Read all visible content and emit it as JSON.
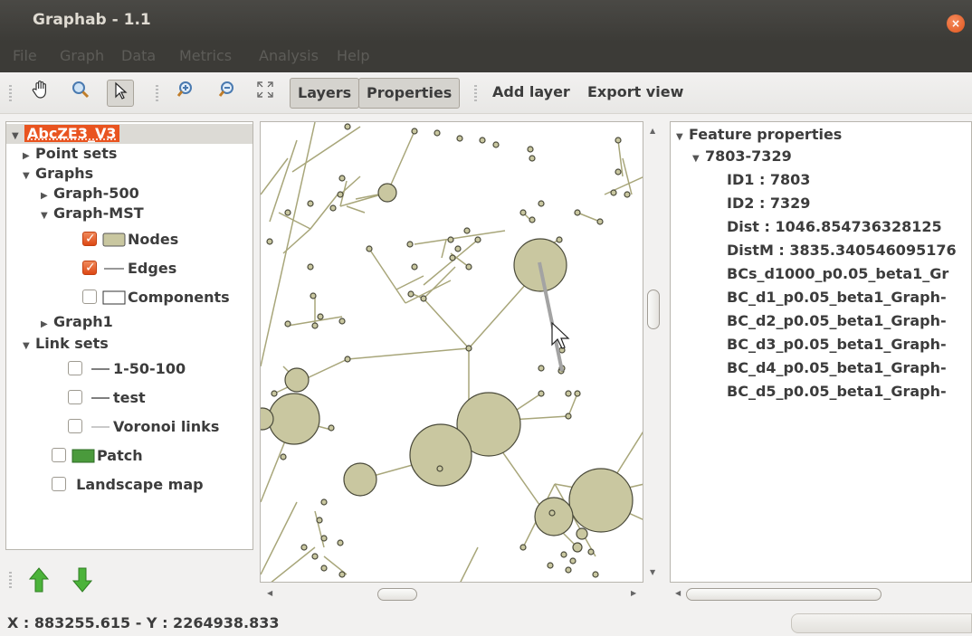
{
  "window": {
    "title": "Graphab - 1.1",
    "close_icon": "close-icon"
  },
  "menu": [
    "File",
    "Graph",
    "Data",
    "Metrics",
    "Analysis",
    "Help"
  ],
  "toolbar": {
    "tools": [
      "pan-hand-icon",
      "zoom-magnifier-icon",
      "select-pointer-icon",
      "zoom-in-icon",
      "zoom-out-icon",
      "full-extent-icon"
    ],
    "layers_label": "Layers",
    "properties_label": "Properties",
    "add_layer_label": "Add layer",
    "export_view_label": "Export view"
  },
  "layers_tree": {
    "root": "AbcZE3_V3",
    "point_sets": "Point sets",
    "graphs": "Graphs",
    "graph_500": "Graph-500",
    "graph_mst": "Graph-MST",
    "nodes": "Nodes",
    "edges": "Edges",
    "components": "Components",
    "graph1": "Graph1",
    "link_sets": "Link sets",
    "link_1_50_100": "1-50-100",
    "link_test": "test",
    "link_voronoi": "Voronoi links",
    "patch": "Patch",
    "landscape_map": "Landscape map",
    "colors": {
      "node_fill": "#c9c7a0",
      "edge": "#a8a67a",
      "patch": "#4a9a3c",
      "accent": "#e95420"
    }
  },
  "properties": {
    "header": "Feature properties",
    "feature": "7803-7329",
    "fields": [
      "ID1 : 7803",
      "ID2 : 7329",
      "Dist : 1046.854736328125",
      "DistM : 3835.340546095176",
      "BCs_d1000_p0.05_beta1_Gr",
      "BC_d1_p0.05_beta1_Graph-",
      "BC_d2_p0.05_beta1_Graph-",
      "BC_d3_p0.05_beta1_Graph-",
      "BC_d4_p0.05_beta1_Graph-",
      "BC_d5_p0.05_beta1_Graph-"
    ]
  },
  "status": {
    "coords": "X : 883255.615 - Y : 2264938.833"
  }
}
